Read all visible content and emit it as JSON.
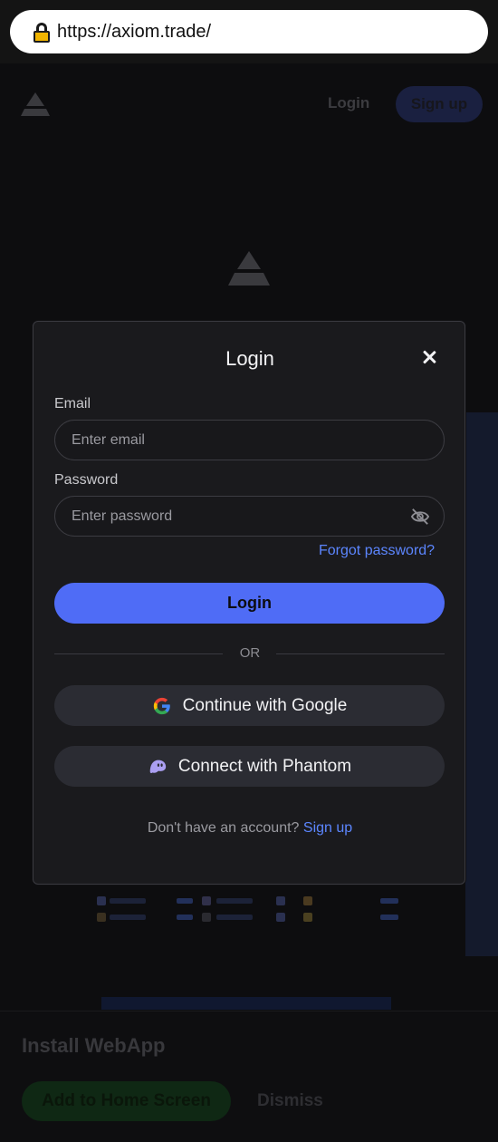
{
  "browser": {
    "url": "https://axiom.trade/"
  },
  "header": {
    "login_label": "Login",
    "signup_label": "Sign up"
  },
  "modal": {
    "title": "Login",
    "email": {
      "label": "Email",
      "placeholder": "Enter email",
      "value": ""
    },
    "password": {
      "label": "Password",
      "placeholder": "Enter password",
      "value": ""
    },
    "forgot_label": "Forgot password?",
    "login_button": "Login",
    "divider_text": "OR",
    "google_button": "Continue with Google",
    "phantom_button": "Connect with Phantom",
    "footer_prompt": "Don't have an account?",
    "footer_link": "Sign up"
  },
  "install_banner": {
    "title": "Install WebApp",
    "add_button": "Add to Home Screen",
    "dismiss_button": "Dismiss"
  },
  "colors": {
    "accent": "#4f6cf6",
    "link": "#5c86ff",
    "modal_bg": "#1a1a1d",
    "button_dark": "#2b2c33"
  }
}
